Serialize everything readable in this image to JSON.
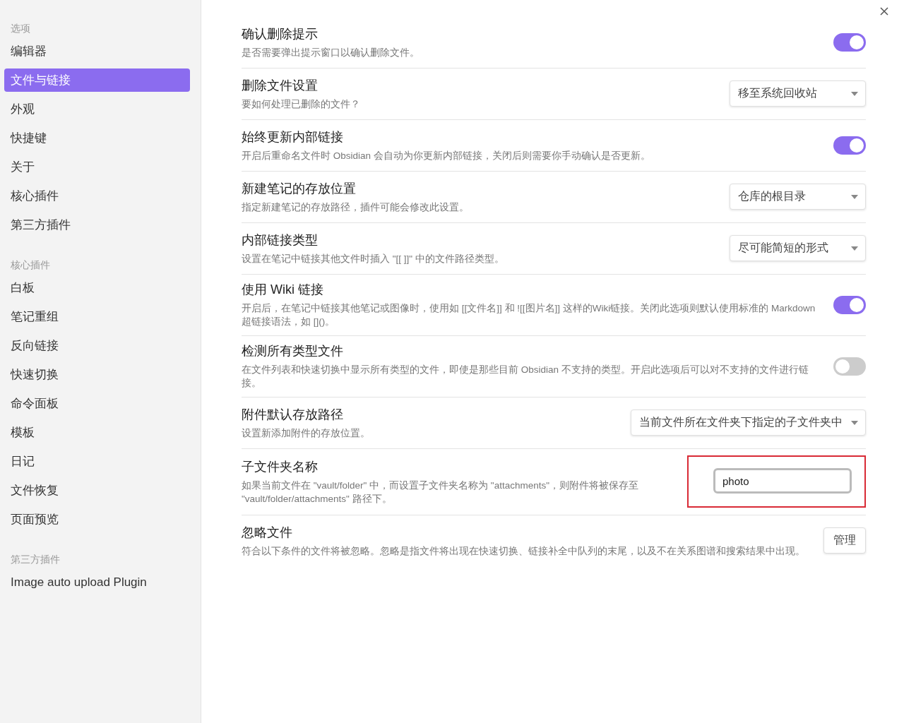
{
  "sidebar": {
    "sections": [
      {
        "heading": "选项",
        "items": [
          {
            "label": "编辑器",
            "selected": false
          },
          {
            "label": "文件与链接",
            "selected": true
          },
          {
            "label": "外观",
            "selected": false
          },
          {
            "label": "快捷键",
            "selected": false
          },
          {
            "label": "关于",
            "selected": false
          },
          {
            "label": "核心插件",
            "selected": false
          },
          {
            "label": "第三方插件",
            "selected": false
          }
        ]
      },
      {
        "heading": "核心插件",
        "items": [
          {
            "label": "白板",
            "selected": false
          },
          {
            "label": "笔记重组",
            "selected": false
          },
          {
            "label": "反向链接",
            "selected": false
          },
          {
            "label": "快速切换",
            "selected": false
          },
          {
            "label": "命令面板",
            "selected": false
          },
          {
            "label": "模板",
            "selected": false
          },
          {
            "label": "日记",
            "selected": false
          },
          {
            "label": "文件恢复",
            "selected": false
          },
          {
            "label": "页面预览",
            "selected": false
          }
        ]
      },
      {
        "heading": "第三方插件",
        "items": [
          {
            "label": "Image auto upload Plugin",
            "selected": false
          }
        ]
      }
    ]
  },
  "settings": [
    {
      "kind": "toggle",
      "title": "确认删除提示",
      "description": "是否需要弹出提示窗口以确认删除文件。",
      "on": true
    },
    {
      "kind": "dropdown",
      "title": "删除文件设置",
      "description": "要如何处理已删除的文件？",
      "value": "移至系统回收站"
    },
    {
      "kind": "toggle",
      "title": "始终更新内部链接",
      "description": "开启后重命名文件时 Obsidian 会自动为你更新内部链接，关闭后则需要你手动确认是否更新。",
      "on": true
    },
    {
      "kind": "dropdown",
      "title": "新建笔记的存放位置",
      "description": "指定新建笔记的存放路径，插件可能会修改此设置。",
      "value": "仓库的根目录"
    },
    {
      "kind": "dropdown",
      "title": "内部链接类型",
      "description": "设置在笔记中链接其他文件时插入 \"[[ ]]\" 中的文件路径类型。",
      "value": "尽可能简短的形式"
    },
    {
      "kind": "toggle",
      "title": "使用 Wiki 链接",
      "description": "开启后，在笔记中链接其他笔记或图像时，使用如 [[文件名]] 和 ![[图片名]] 这样的Wiki链接。关闭此选项则默认使用标准的 Markdown 超链接语法，如 []()。",
      "on": true
    },
    {
      "kind": "toggle",
      "title": "检测所有类型文件",
      "description": "在文件列表和快速切换中显示所有类型的文件，即使是那些目前 Obsidian 不支持的类型。开启此选项后可以对不支持的文件进行链接。",
      "on": false
    },
    {
      "kind": "dropdown",
      "title": "附件默认存放路径",
      "description": "设置新添加附件的存放位置。",
      "value": "当前文件所在文件夹下指定的子文件夹中"
    },
    {
      "kind": "text",
      "title": "子文件夹名称",
      "description": "如果当前文件在 \"vault/folder\" 中，而设置子文件夹名称为 \"attachments\"，则附件将被保存至 \"vault/folder/attachments\" 路径下。",
      "value": "photo",
      "highlighted": true
    },
    {
      "kind": "button",
      "title": "忽略文件",
      "description": "符合以下条件的文件将被忽略。忽略是指文件将出现在快速切换、链接补全中队列的末尾，以及不在关系图谱和搜索结果中出现。",
      "button": "管理"
    }
  ]
}
